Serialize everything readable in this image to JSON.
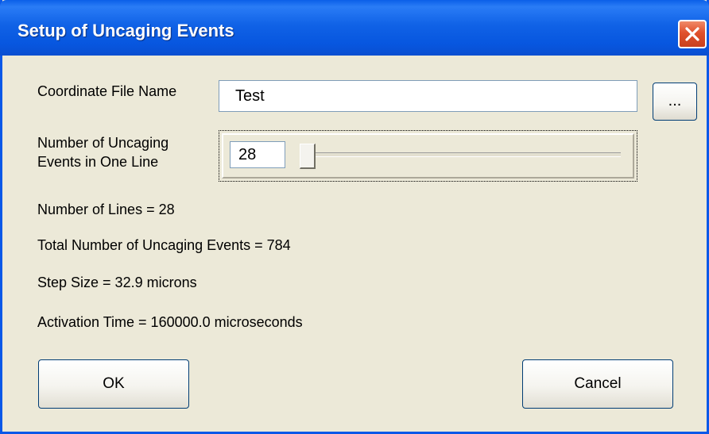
{
  "window": {
    "title": "Setup of Uncaging Events",
    "close_icon": "close-icon",
    "accent_color": "#0a58e8",
    "background_color": "#ece9d8"
  },
  "coordinate_file": {
    "label": "Coordinate File Name",
    "value": "Test",
    "browse_label": "..."
  },
  "events_per_line": {
    "label_line1": "Number of Uncaging",
    "label_line2": "Events in One Line",
    "value": "28",
    "slider_position": 0.0
  },
  "info": {
    "number_of_lines": "Number of Lines = 28",
    "total_events": "Total Number of Uncaging Events = 784",
    "step_size": "Step Size = 32.9 microns",
    "activation_time": "Activation Time = 160000.0 microseconds"
  },
  "buttons": {
    "ok_label": "OK",
    "cancel_label": "Cancel"
  }
}
